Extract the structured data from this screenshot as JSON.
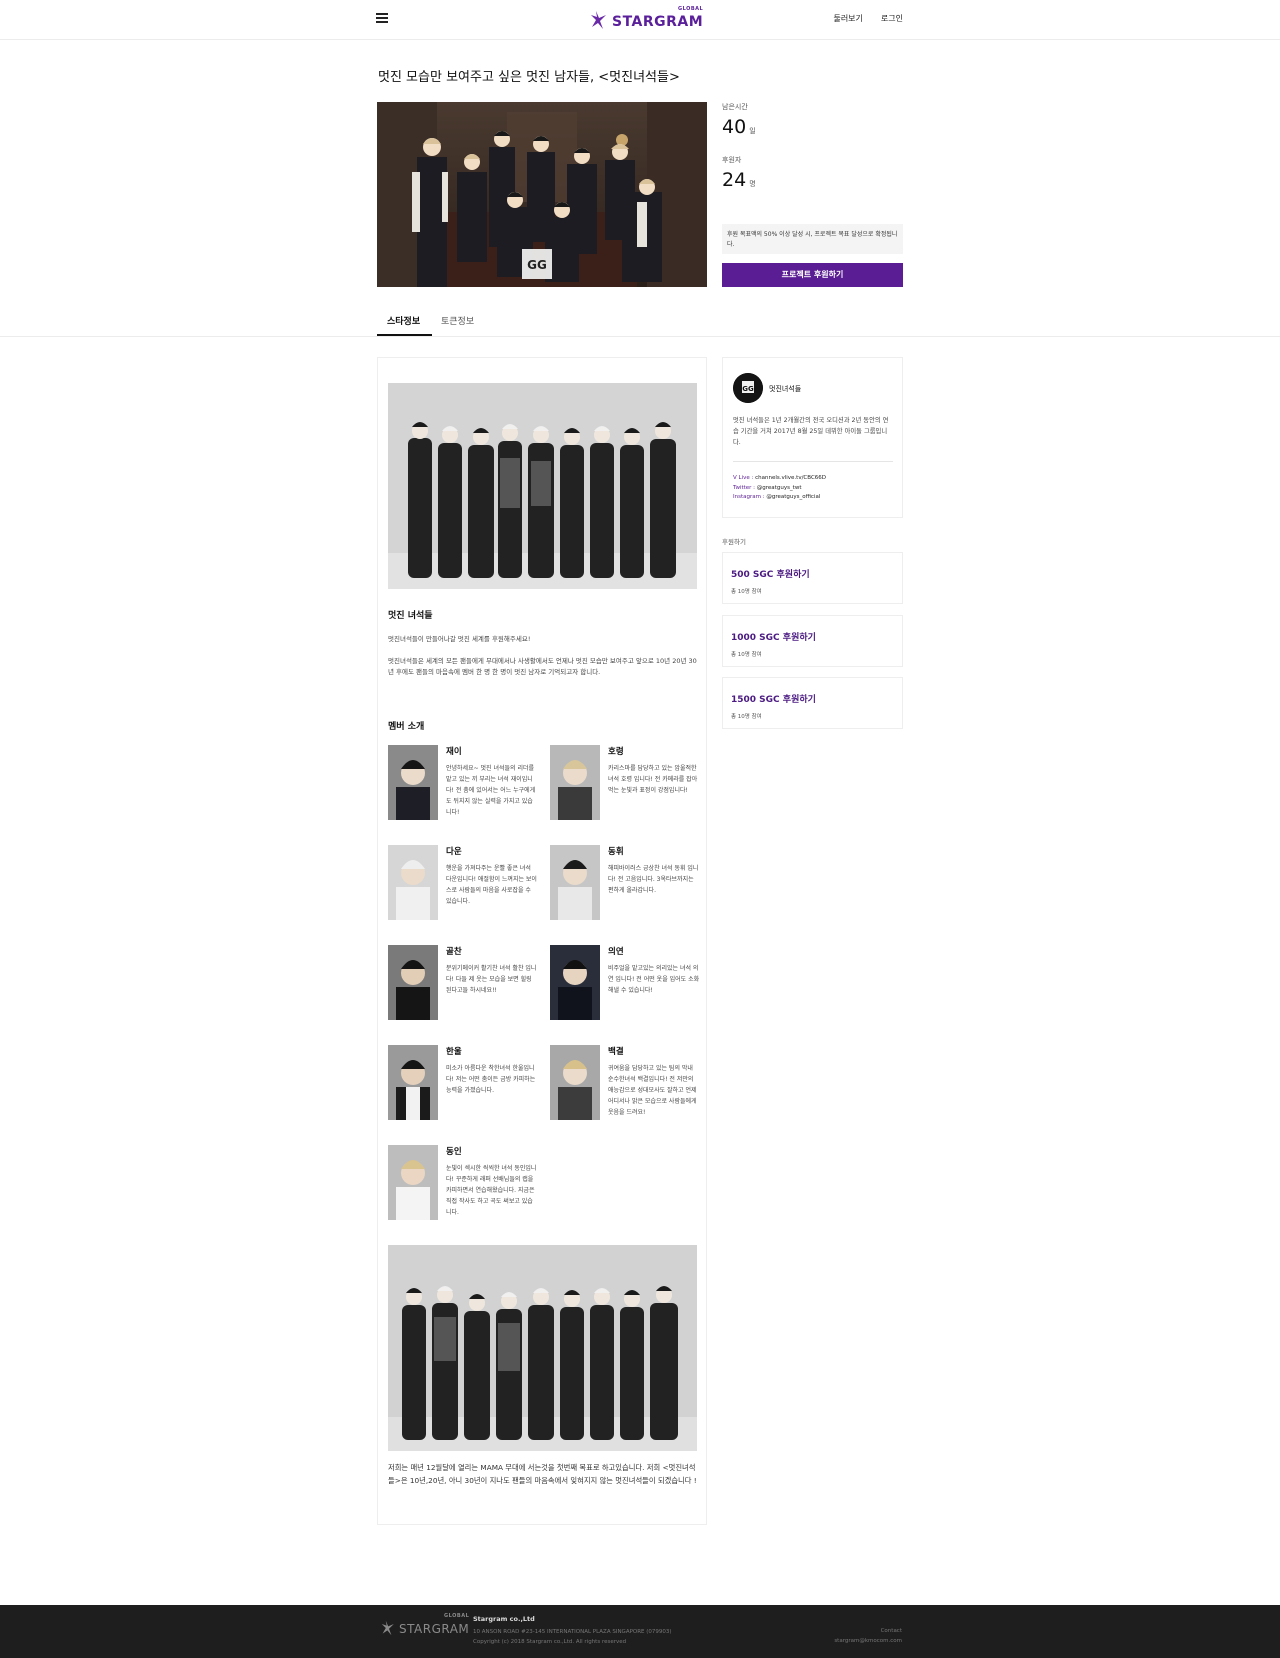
{
  "header": {
    "logo_small": "GLOBAL",
    "logo_word": "STARGRAM",
    "nav_browse": "둘러보기",
    "nav_login": "로그인"
  },
  "project": {
    "title": "멋진 모습만 보여주고 싶은 멋진 남자들, <멋진녀석들>",
    "remaining_label": "남은시간",
    "remaining_value": "40",
    "remaining_unit": "일",
    "backers_label": "후원자",
    "backers_value": "24",
    "backers_unit": "명",
    "notice": "후원 목표액의 50% 이상 달성 시, 프로젝트 목표 달성으로 확정됩니다.",
    "support_button": "프로젝트 후원하기"
  },
  "tabs": [
    {
      "label": "스타정보",
      "active": true
    },
    {
      "label": "토큰정보",
      "active": false
    }
  ],
  "content": {
    "intro_title": "멋진 녀석들",
    "intro_p1": "멋진녀석들이 만들어나갈 멋진 세계를 후원해주세요!",
    "intro_p2": "멋진녀석들은 세계의 모든 팬들에게 무대에서나 사생활에서도 언제나 멋진 모습만 보여주고 앞으로 10년 20년 30년 후에도 팬들의 마음속에 멤버 한 명 한 명이 멋진 남자로 기억되고자 합니다.",
    "members_title": "멤버 소개",
    "members": [
      {
        "name": "재이",
        "desc": "안녕하세요~ 멋진 녀석들의 리더를 맡고 있는 끼 부리는 녀석 재이입니다! 전 춤에 있어서는 어느 누구에게도 뒤지지 않는 실력을 가지고 있습니다!"
      },
      {
        "name": "호령",
        "desc": "카리스마를 담당하고 있는 암울적한 녀석 호령 입니다! 전 카메라를 잡아먹는 눈빛과 표정이 강점입니다!"
      },
      {
        "name": "다운",
        "desc": "행운을 가져다주는 운빨 좋은 녀석 다운입니다! 애절함이 느껴지는 보이스로 사람들의 마음을 사로잡을 수 있습니다."
      },
      {
        "name": "동휘",
        "desc": "해피바이러스 긍상찬 녀석 동휘 입니다! 전 고음입니다. 3옥타브까지는 편하게 올라갑니다."
      },
      {
        "name": "골찬",
        "desc": "분위기메이커 활기찬 녀석 활찬 입니다! 다들 제 웃는 모습을 보면 힐링 된다고들 하시네요!!"
      },
      {
        "name": "의연",
        "desc": "비주얼을 맡고있는 의리있는 녀석 의연 입니다! 전 어떤 옷을 입어도 소화해낼 수 있습니다!"
      },
      {
        "name": "한울",
        "desc": "미소가 아름다운 착한녀석 한울입니다! 저는 어떤 춤이든 금방 카피하는 능력을 가졌습니다."
      },
      {
        "name": "백결",
        "desc": "귀여움을 담당하고 있는 팀의 막내 순수한녀석 백결입니다! 전 저만의 애능감으로 성대모사도 잘하고 언제 어디서나 밝은 모습으로 사람들에게 웃음을 드려요!"
      },
      {
        "name": "동인",
        "desc": "눈빛이 섹시한 씩씩한 녀석 동인입니다! 꾸준하게 래퍼 선배님들의 랩을 카피하면서 연습해왔습니다. 지금은 직접 작사도 하고 곡도 써보고 있습니다."
      }
    ],
    "bottom_text": "저희는 매년 12월달에 열리는 MAMA 무대에 서는것을 첫번째 목표로 하고있습니다. 저희 <멋진녀석들>은 10년,20년, 아니 30년이 지나도 팬들의 마음속에서 잊혀지지 않는 멋진녀석들이 되겠습니다 !"
  },
  "sidebar": {
    "profile_name": "멋진녀석들",
    "profile_bio": "멋진 녀석들은 1년 2개월간의 전국 오디션과 2년 동안의 연습 기간을 거쳐 2017년 8월 25일 데뷔한 아이돌 그룹입니다.",
    "links": [
      {
        "label": "V Live : ",
        "value": "channels.vlive.tv/CBC66D"
      },
      {
        "label": "Twitter : ",
        "value": "@greatguys_twt"
      },
      {
        "label": "Instagram : ",
        "value": "@greatguys_official"
      }
    ],
    "sponsor_label": "후원하기",
    "sponsor_options": [
      {
        "amount": "500 SGC 후원하기",
        "meta": "총 10명 참여"
      },
      {
        "amount": "1000 SGC 후원하기",
        "meta": "총 10명 참여"
      },
      {
        "amount": "1500 SGC 후원하기",
        "meta": "총 10명 참여"
      }
    ]
  },
  "footer": {
    "logo_small": "GLOBAL",
    "logo_word": "STARGRAM",
    "company": "Stargram co.,Ltd",
    "address": "10 ANSON ROAD #23-145 INTERNATIONAL PLAZA SINGAPORE (079903)",
    "copyright": "Copyright (c) 2018 Stargram co.,Ltd. All rights reserved",
    "contact_label": "Contact",
    "contact_email": "stargram@kmocom.com"
  },
  "colors": {
    "brand_purple": "#5b1d94",
    "footer_bg": "#1e1e1e"
  }
}
